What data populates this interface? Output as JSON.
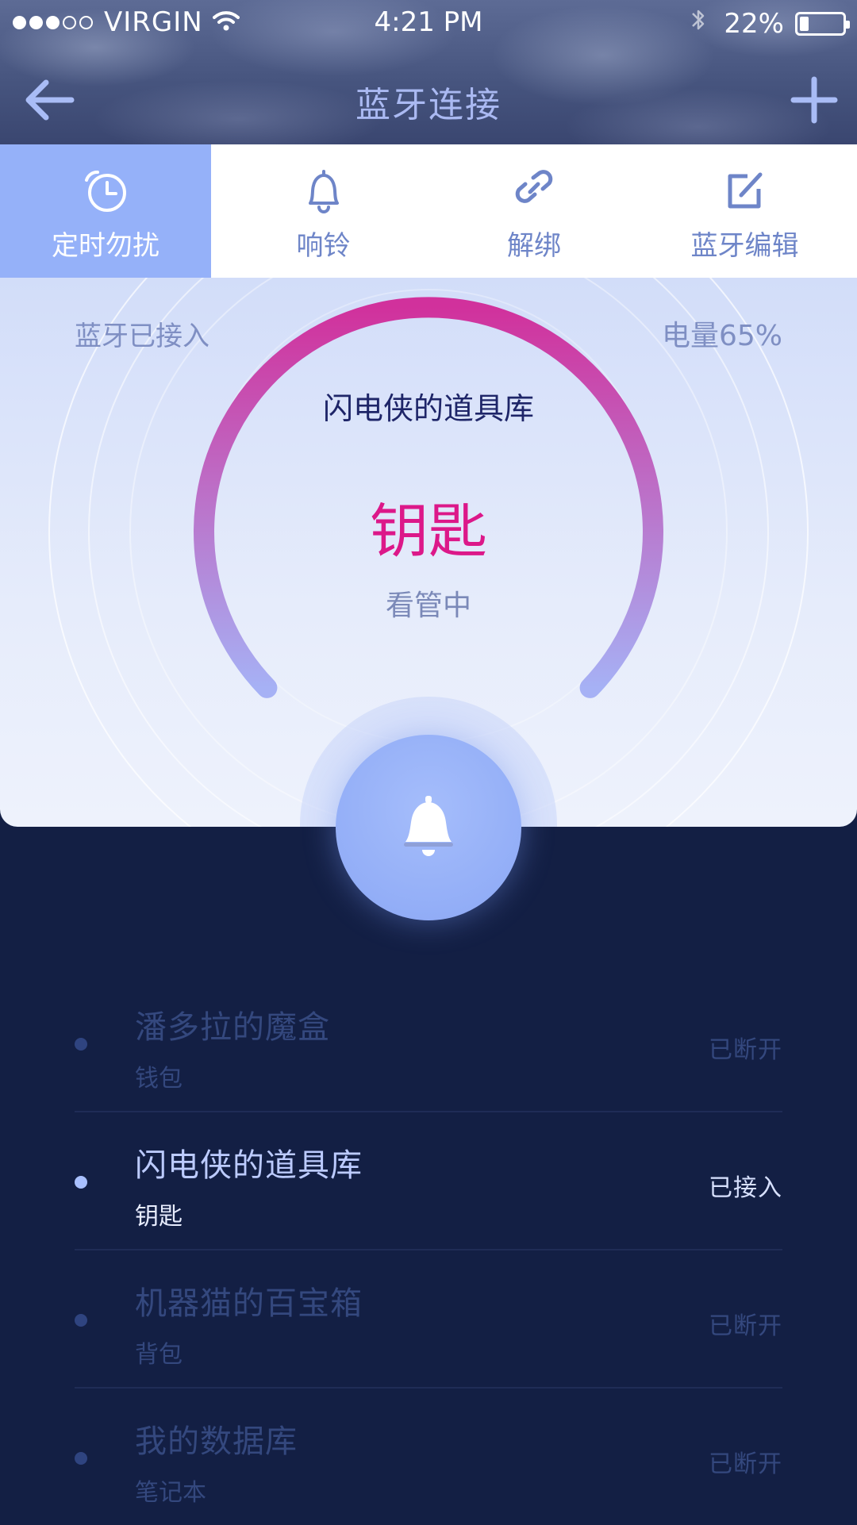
{
  "status_bar": {
    "signal_bars_filled": 3,
    "signal_bars_total": 5,
    "carrier": "VIRGIN",
    "time": "4:21 PM",
    "battery_percent": "22%",
    "battery_level": 0.22
  },
  "nav": {
    "title": "蓝牙连接",
    "back_icon": "arrow-left-icon",
    "add_icon": "plus-icon"
  },
  "tabs": [
    {
      "label": "定时勿扰",
      "icon": "alarm-clock-icon",
      "active": true
    },
    {
      "label": "响铃",
      "icon": "bell-icon",
      "active": false
    },
    {
      "label": "解绑",
      "icon": "unlink-icon",
      "active": false
    },
    {
      "label": "蓝牙编辑",
      "icon": "edit-icon",
      "active": false
    }
  ],
  "card": {
    "connection_status": "蓝牙已接入",
    "battery": "电量65%",
    "device_name": "闪电侠的道具库",
    "item_name": "钥匙",
    "guard_status": "看管中"
  },
  "ring_button": {
    "icon": "bell-icon"
  },
  "devices": [
    {
      "name": "潘多拉的魔盒",
      "item": "钱包",
      "status": "已断开",
      "connected": false
    },
    {
      "name": "闪电侠的道具库",
      "item": "钥匙",
      "status": "已接入",
      "connected": true
    },
    {
      "name": "机器猫的百宝箱",
      "item": "背包",
      "status": "已断开",
      "connected": false
    },
    {
      "name": "我的数据库",
      "item": "笔记本",
      "status": "已断开",
      "connected": false
    }
  ],
  "colors": {
    "accent": "#95b1f9",
    "item_highlight": "#dc1889",
    "list_background": "#131f44",
    "arc_gradient_start": "#d1319c",
    "arc_gradient_end": "#a6b1f5"
  }
}
